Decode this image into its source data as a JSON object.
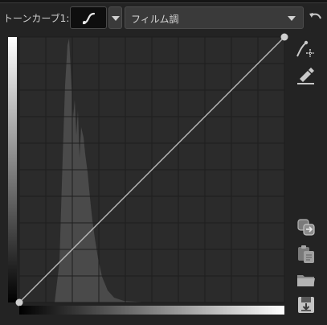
{
  "header": {
    "curve_label": "トーンカーブ1:",
    "preset_value": "フィルム調"
  },
  "icons": {
    "curve_tool": "curve-brush-icon",
    "dropdown": "chevron-down-icon",
    "reset": "undo-arrow-icon",
    "add_point": "add-curve-point-icon",
    "pick_point": "eyedropper-point-icon",
    "copy": "copy-icon",
    "paste": "paste-icon",
    "open": "folder-icon",
    "save": "save-icon"
  },
  "curve": {
    "grid_divisions": 10,
    "points": [
      {
        "input": 0,
        "output": 0
      },
      {
        "input": 255,
        "output": 255
      }
    ],
    "histogram_histogram_note": ""
  },
  "colors": {
    "background": "#232323",
    "graph_background": "#2b2b2b",
    "grid_line": "#1e1e1e",
    "histogram_fill": "#4a4a4a",
    "curve_line": "#b9b9b9",
    "control_point": "#cfcfcf"
  }
}
